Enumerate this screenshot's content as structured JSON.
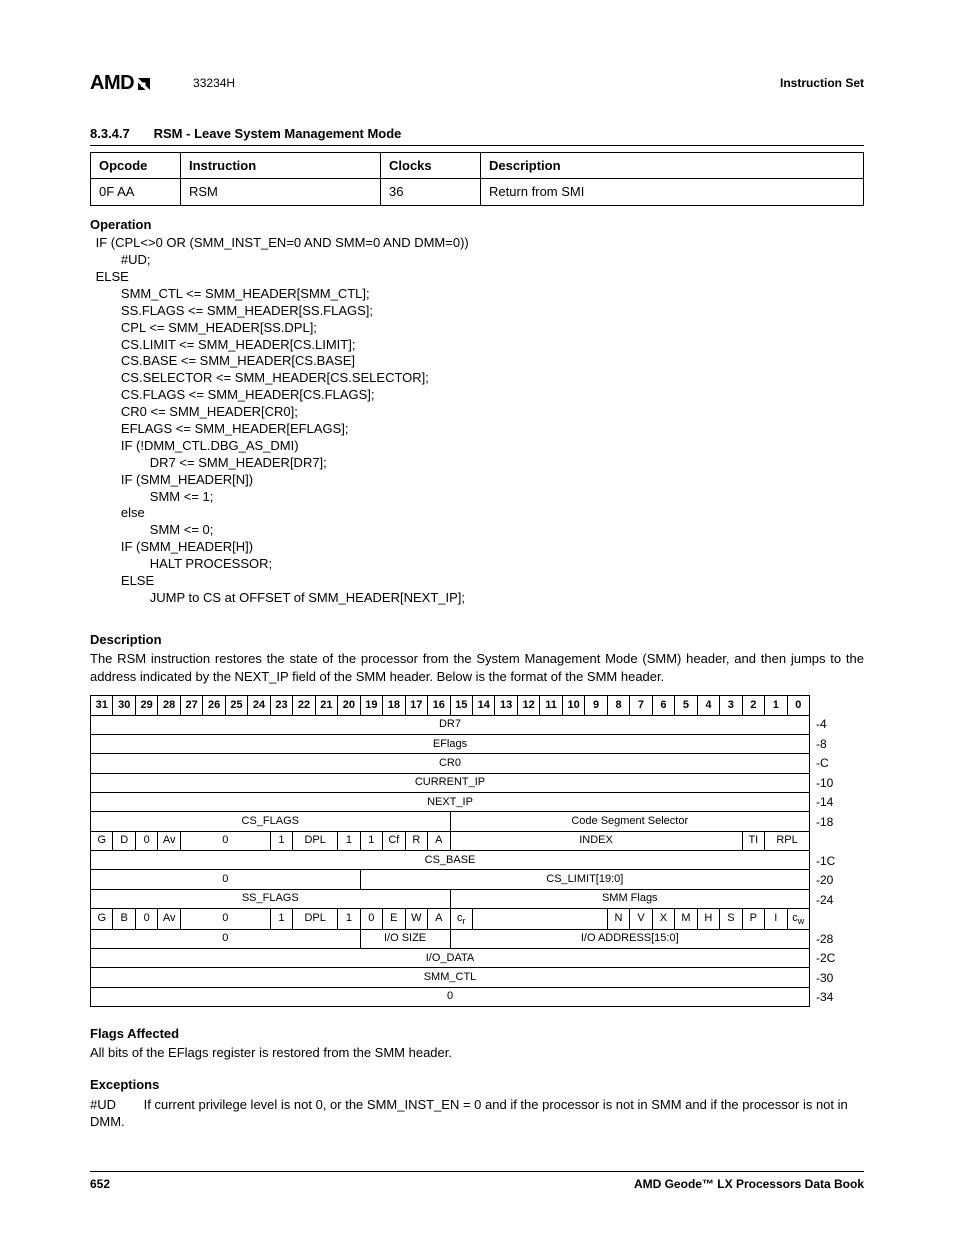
{
  "header": {
    "logo_text": "AMD",
    "docnum": "33234H",
    "right": "Instruction Set"
  },
  "section": {
    "num": "8.3.4.7",
    "title": "RSM - Leave System Management Mode"
  },
  "opcode_table": {
    "headers": {
      "opcode": "Opcode",
      "instruction": "Instruction",
      "clocks": "Clocks",
      "description": "Description"
    },
    "row": {
      "opcode": "0F AA",
      "instruction": "RSM",
      "clocks": "36",
      "description": "Return from SMI"
    }
  },
  "operation": {
    "heading": "Operation",
    "code": " IF (CPL<>0 OR (SMM_INST_EN=0 AND SMM=0 AND DMM=0))\n        #UD;\n ELSE\n        SMM_CTL <= SMM_HEADER[SMM_CTL];\n        SS.FLAGS <= SMM_HEADER[SS.FLAGS];\n        CPL <= SMM_HEADER[SS.DPL];\n        CS.LIMIT <= SMM_HEADER[CS.LIMIT];\n        CS.BASE <= SMM_HEADER[CS.BASE]\n        CS.SELECTOR <= SMM_HEADER[CS.SELECTOR];\n        CS.FLAGS <= SMM_HEADER[CS.FLAGS];\n        CR0 <= SMM_HEADER[CR0];\n        EFLAGS <= SMM_HEADER[EFLAGS];\n        IF (!DMM_CTL.DBG_AS_DMI)\n                DR7 <= SMM_HEADER[DR7];\n        IF (SMM_HEADER[N])\n                SMM <= 1;\n        else\n                SMM <= 0;\n        IF (SMM_HEADER[H])\n                HALT PROCESSOR;\n        ELSE\n                JUMP to CS at OFFSET of SMM_HEADER[NEXT_IP];"
  },
  "description": {
    "heading": "Description",
    "text": "The RSM instruction restores the state of the processor from the System Management Mode (SMM) header, and then jumps to the address indicated by the NEXT_IP field of the SMM header. Below is the format of the SMM header."
  },
  "bittable": {
    "bits": [
      "31",
      "30",
      "29",
      "28",
      "27",
      "26",
      "25",
      "24",
      "23",
      "22",
      "21",
      "20",
      "19",
      "18",
      "17",
      "16",
      "15",
      "14",
      "13",
      "12",
      "11",
      "10",
      "9",
      "8",
      "7",
      "6",
      "5",
      "4",
      "3",
      "2",
      "1",
      "0"
    ],
    "rows": {
      "dr7": "DR7",
      "eflags": "EFlags",
      "cr0": "CR0",
      "current_ip": "CURRENT_IP",
      "next_ip": "NEXT_IP",
      "cs_flags": "CS_FLAGS",
      "css": "Code Segment Selector",
      "cs_g": "G",
      "cs_d": "D",
      "cs_0": "0",
      "cs_av": "Av",
      "cs_zero2": "0",
      "cs_1a": "1",
      "cs_dpl": "DPL",
      "cs_1b": "1",
      "cs_1c": "1",
      "cs_cf": "Cf",
      "cs_r": "R",
      "cs_a": "A",
      "index": "INDEX",
      "ti": "TI",
      "rpl": "RPL",
      "cs_base": "CS_BASE",
      "cs_limit_zero": "0",
      "cs_limit": "CS_LIMIT[19:0]",
      "ss_flags": "SS_FLAGS",
      "smm_flags": "SMM Flags",
      "ss_g": "G",
      "ss_b": "B",
      "ss_0": "0",
      "ss_av": "Av",
      "ss_zero2": "0",
      "ss_1a": "1",
      "ss_dpl": "DPL",
      "ss_1b": "1",
      "ss_0b": "0",
      "ss_e": "E",
      "ss_w": "W",
      "ss_a": "A",
      "cr": "c",
      "cr_sub": "r",
      "sm_n": "N",
      "sm_v": "V",
      "sm_x": "X",
      "sm_m": "M",
      "sm_h": "H",
      "sm_s": "S",
      "sm_p": "P",
      "sm_i": "I",
      "cw": "c",
      "cw_sub": "w",
      "row28_zero": "0",
      "io_size": "I/O SIZE",
      "io_addr": "I/O ADDRESS[15:0]",
      "io_data": "I/O_DATA",
      "smm_ctl": "SMM_CTL",
      "zero_row": "0"
    },
    "offsets": [
      "-4",
      "-8",
      "-C",
      "-10",
      "-14",
      "-18",
      "",
      "-1C",
      "-20",
      "-24",
      "",
      "-28",
      "-2C",
      "-30",
      "-34"
    ]
  },
  "flags": {
    "heading": "Flags Affected",
    "text": "All bits of the EFlags register is restored from the SMM header."
  },
  "exceptions": {
    "heading": "Exceptions",
    "code": "#UD",
    "text": "If current privilege level is not 0, or the SMM_INST_EN = 0 and if the processor is not in SMM and if the processor is not in DMM."
  },
  "footer": {
    "page": "652",
    "right": "AMD Geode™ LX Processors Data Book"
  }
}
